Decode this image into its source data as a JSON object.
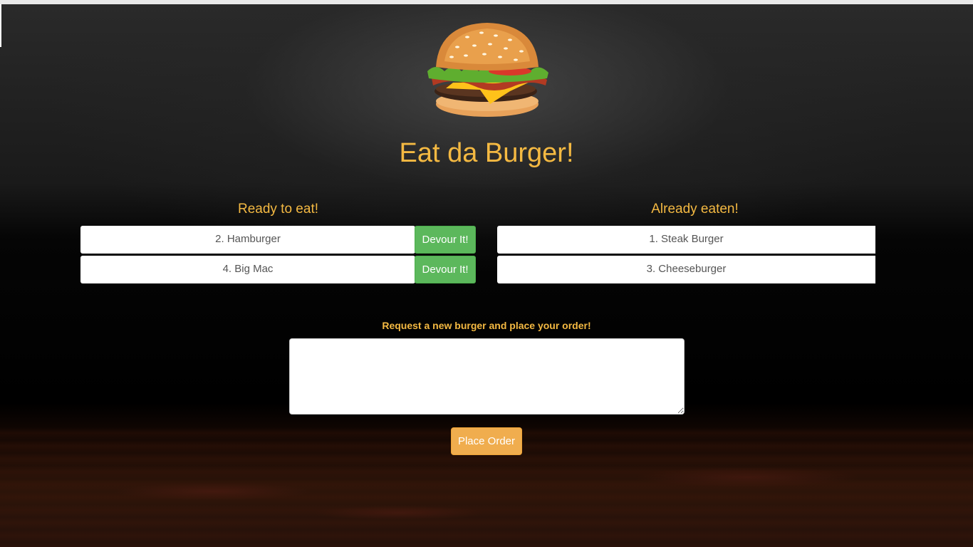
{
  "header": {
    "logo_icon": "burger-icon",
    "title": "Eat da Burger!"
  },
  "ready": {
    "heading": "Ready to eat!",
    "items": [
      {
        "label": "2. Hamburger",
        "button": "Devour It!"
      },
      {
        "label": "4. Big Mac",
        "button": "Devour It!"
      }
    ]
  },
  "eaten": {
    "heading": "Already eaten!",
    "items": [
      {
        "label": "1. Steak Burger"
      },
      {
        "label": "3. Cheeseburger"
      }
    ]
  },
  "order": {
    "label": "Request a new burger and place your order!",
    "input_value": "",
    "button": "Place Order"
  },
  "colors": {
    "accent": "#f4b942",
    "devour_button": "#5cb85c",
    "place_button": "#f0ad4e"
  }
}
